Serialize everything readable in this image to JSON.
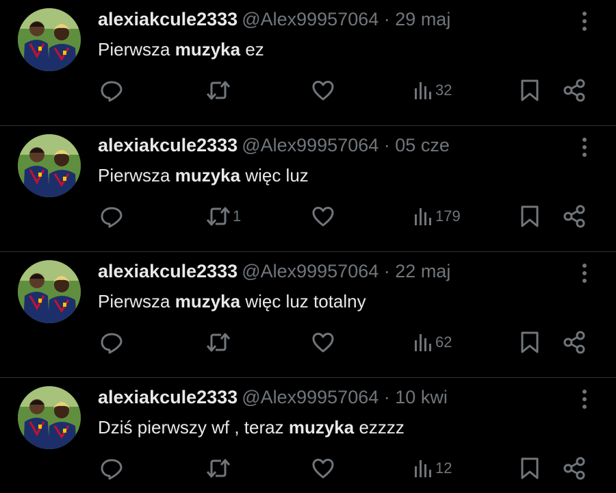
{
  "tweets": [
    {
      "user_name": "alexiakcule2333",
      "handle": "@Alex99957064",
      "separator": "·",
      "date": "29 maj",
      "text_before": "Pierwsza ",
      "text_bold": "muzyka",
      "text_after": " ez",
      "retweets": "",
      "views": "32"
    },
    {
      "user_name": "alexiakcule2333",
      "handle": "@Alex99957064",
      "separator": "·",
      "date": "05 cze",
      "text_before": "Pierwsza ",
      "text_bold": "muzyka",
      "text_after": " więc luz",
      "retweets": "1",
      "views": "179"
    },
    {
      "user_name": "alexiakcule2333",
      "handle": "@Alex99957064",
      "separator": "·",
      "date": "22 maj",
      "text_before": "Pierwsza ",
      "text_bold": "muzyka",
      "text_after": " więc luz totalny",
      "retweets": "",
      "views": "62"
    },
    {
      "user_name": "alexiakcule2333",
      "handle": "@Alex99957064",
      "separator": "·",
      "date": "10 kwi",
      "text_before": "Dziś pierwszy wf , teraz ",
      "text_bold": "muzyka",
      "text_after": " ezzzz",
      "retweets": "",
      "views": "12"
    }
  ],
  "icons": {
    "more": "more-vertical-icon",
    "reply": "reply-icon",
    "retweet": "retweet-icon",
    "like": "heart-icon",
    "views": "views-chart-icon",
    "bookmark": "bookmark-icon",
    "share": "share-icon"
  },
  "colors": {
    "background": "#000000",
    "primary_text": "#e7e9ea",
    "secondary_text": "#71767b",
    "divider": "#2f3336"
  }
}
